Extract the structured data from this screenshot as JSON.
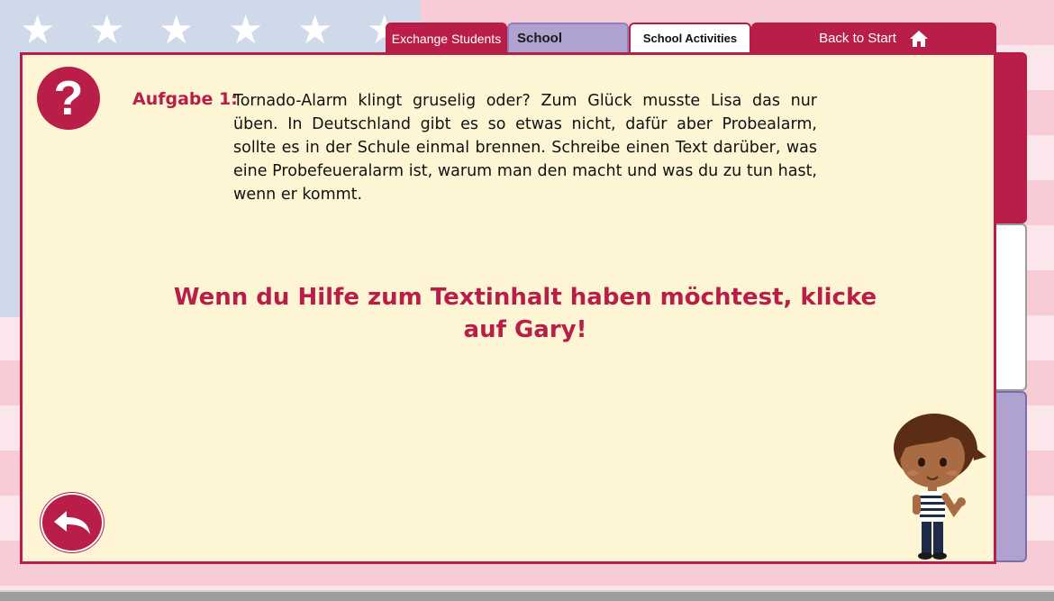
{
  "tabs": {
    "exchange_students": "Exchange Students",
    "school": "School",
    "school_activities": "School Activities",
    "back_to_start": "Back to Start"
  },
  "task": {
    "label": "Aufgabe 1:",
    "text": "Tornado-Alarm klingt gruselig oder? Zum Glück musste Lisa das nur üben. In Deutschland gibt es so etwas nicht, dafür aber Probealarm, sollte es in der Schule einmal brennen. Schreibe einen Text darüber, was eine Probefeueralarm ist, warum man den macht und was du zu tun hast, wenn er kommt."
  },
  "hint": {
    "line1": "Wenn du Hilfe zum Textinhalt haben möchtest, klicke",
    "line2": "auf Gary!"
  },
  "icons": {
    "help": "question-mark-icon",
    "home": "home-icon",
    "back": "back-arrow-icon",
    "character": "gary-character"
  },
  "colors": {
    "accent": "#b81e48",
    "panel": "#fdf5d4",
    "school_tab": "#b0a2d0"
  }
}
